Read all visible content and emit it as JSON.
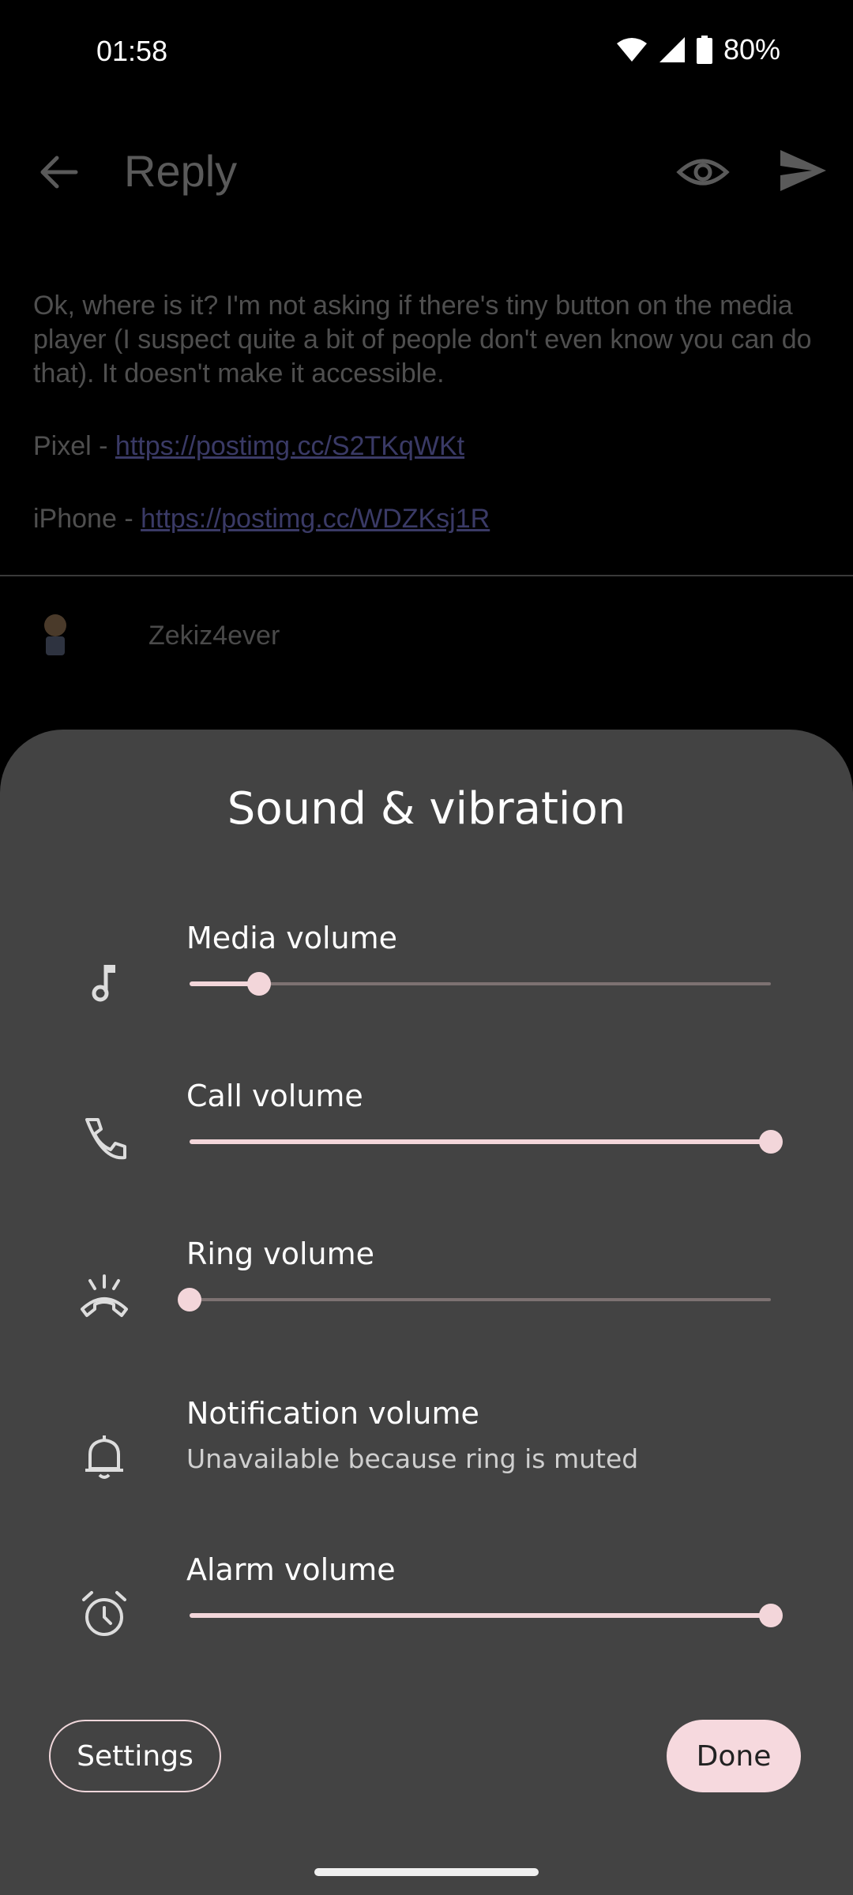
{
  "status_bar": {
    "time": "01:58",
    "battery_text": "80%",
    "icons": [
      "wifi-icon",
      "signal-icon",
      "battery-icon"
    ]
  },
  "background_app": {
    "title": "Reply",
    "icons": [
      "back-arrow-icon",
      "eye-icon",
      "send-icon"
    ],
    "message": {
      "para1": "Ok, where is it? I'm not asking if there's tiny button on the media player (I suspect quite a bit of people don't even know you can do that). It doesn't make it accessible.",
      "pixel_prefix": "Pixel - ",
      "pixel_link": "https://postimg.cc/S2TKqWKt",
      "iphone_prefix": "iPhone - ",
      "iphone_link": "https://postimg.cc/WDZKsj1R"
    },
    "username": "Zekiz4ever"
  },
  "sheet": {
    "title": "Sound & vibration",
    "rows": [
      {
        "label": "Media volume",
        "icon": "music-note-icon",
        "level": 0.12
      },
      {
        "label": "Call volume",
        "icon": "phone-icon",
        "level": 1.0
      },
      {
        "label": "Ring volume",
        "icon": "ring-muted-icon",
        "level": 0.0
      },
      {
        "label": "Notification volume",
        "icon": "bell-icon",
        "subtitle": "Unavailable because ring is muted"
      },
      {
        "label": "Alarm volume",
        "icon": "alarm-icon",
        "level": 1.0
      }
    ],
    "settings_label": "Settings",
    "done_label": "Done"
  },
  "colors": {
    "sheet_bg": "#434343",
    "accent": "#f3d6da",
    "track": "#7d7272"
  }
}
